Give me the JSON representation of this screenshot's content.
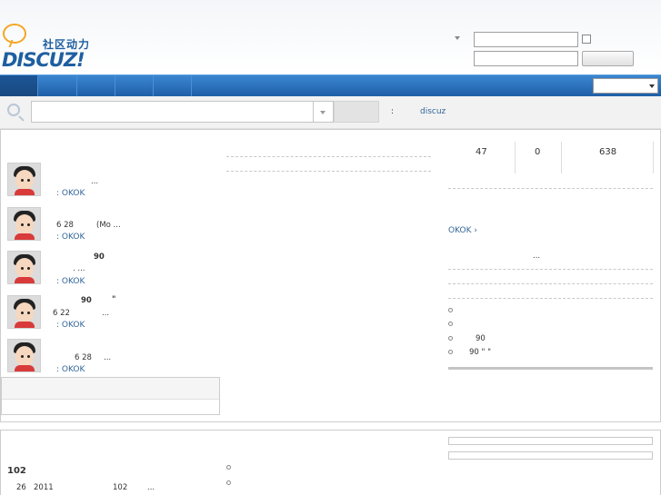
{
  "header": {
    "logo": {
      "cn": "社区动力",
      "brand": "DISCUZ!"
    }
  },
  "search": {
    "hot_label": ":",
    "hot_link": "discuz"
  },
  "stats": {
    "members": "47",
    "online": "0",
    "posts": "638"
  },
  "feed": [
    {
      "line1": "...",
      "line1b": "",
      "author": ": OKOK"
    },
    {
      "line1": "6 28",
      "line1b": "(Mo ...",
      "author": ": OKOK"
    },
    {
      "line1": "90",
      "line1b": ". ...",
      "author": ": OKOK"
    },
    {
      "line1": "90",
      "line1b": "\"",
      "line2": "6 22",
      "line2b": "...",
      "author": ": OKOK"
    },
    {
      "line1": "6 28",
      "line1b": "...",
      "author": ": OKOK"
    }
  ],
  "sidebar": {
    "user_link": "OKOK ›",
    "note": "...",
    "list": [
      "",
      "",
      "90",
      "90   \"   \""
    ]
  },
  "bottom": {
    "count": "102",
    "meta_day": "26",
    "meta_year": "2011",
    "meta_count": "102",
    "meta_more": "..."
  }
}
